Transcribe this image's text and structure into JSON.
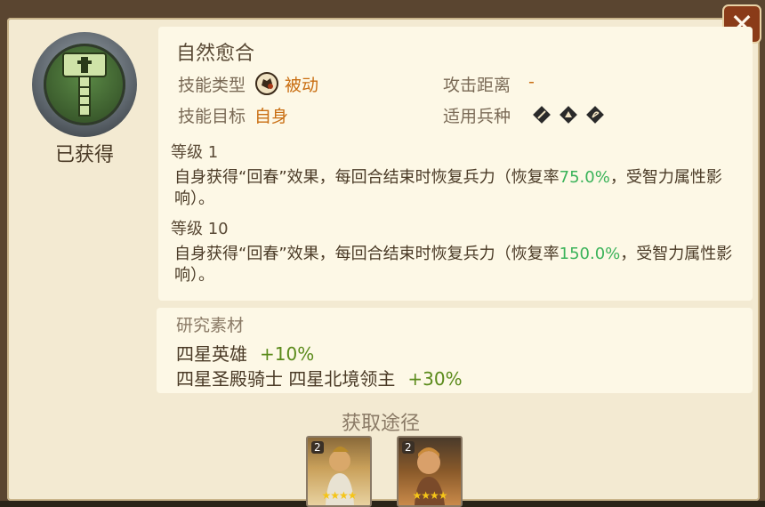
{
  "close_icon": "close-icon",
  "skill": {
    "name": "自然愈合",
    "status": "已获得",
    "icon": "hammer-icon"
  },
  "stats": {
    "type_label": "技能类型",
    "type_icon": "fist-icon",
    "type_value": "被动",
    "target_label": "技能目标",
    "target_value": "自身",
    "range_label": "攻击距离",
    "range_value": "-",
    "troop_label": "适用兵种",
    "troop_icons": [
      "infantry-icon",
      "cavalry-icon",
      "archer-icon"
    ]
  },
  "levels": [
    {
      "label": "等级 1",
      "desc_before": "自身获得“回春”效果，每回合结束时恢复兵力（恢复率",
      "desc_highlight": "75.0%",
      "desc_after": "，受智力属性影响）。"
    },
    {
      "label": "等级 10",
      "desc_before": "自身获得“回春”效果，每回合结束时恢复兵力（恢复率",
      "desc_highlight": "150.0%",
      "desc_after": "，受智力属性影响）。"
    }
  ],
  "research": {
    "title": "研究素材",
    "items": [
      {
        "name": "四星英雄",
        "bonus": "+10%"
      },
      {
        "name": "四星圣殿骑士 四星北境领主",
        "bonus": "+30%"
      }
    ]
  },
  "acquire": {
    "title": "获取途径",
    "cards": [
      {
        "badge": "2",
        "stars": "★★★★"
      },
      {
        "badge": "2",
        "stars": "★★★★"
      }
    ]
  },
  "colors": {
    "accent_orange": "#c96e12",
    "highlight_green": "#3bb35a",
    "bonus_green": "#5a8a1a"
  }
}
